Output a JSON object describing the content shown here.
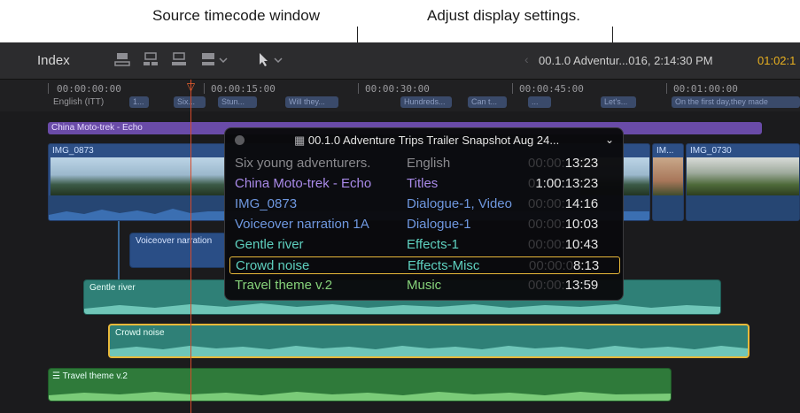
{
  "callouts": {
    "source_timecode": "Source timecode window",
    "display_settings": "Adjust display settings."
  },
  "toolbar": {
    "index_label": "Index",
    "project_name": "00.1.0 Adventur...016, 2:14:30 PM",
    "timecode": "01:02:1"
  },
  "ruler": {
    "marks": [
      "00:00:00:00",
      "00:00:15:00",
      "00:00:30:00",
      "00:00:45:00",
      "00:01:00:00"
    ],
    "caption_lane": "English (ITT)",
    "captions": [
      "1...",
      "Six...",
      "Stun...",
      "Will they...",
      "Hundreds...",
      "Can t...",
      "...",
      "Let's...",
      "On the first day,they made"
    ]
  },
  "timeline": {
    "title_clip": "China Moto-trek - Echo",
    "video_clip_1": "IMG_0873",
    "video_clip_2": "IM...",
    "video_clip_3": "IMG_0730",
    "voiceover_clip": "Voiceover narration",
    "gentle_river_clip": "Gentle river",
    "crowd_noise_clip": "Crowd noise",
    "travel_theme_clip": "Travel theme v.2"
  },
  "popup": {
    "title": "00.1.0 Adventure Trips Trailer Snapshot Aug 24...",
    "rows": [
      {
        "name": "Six young adventurers.",
        "role": "English",
        "tc_dim": "00:00:",
        "tc": "13:23",
        "color": "#8a8a8e",
        "selected": false
      },
      {
        "name": "China Moto-trek - Echo",
        "role": "Titles",
        "tc_dim": "0",
        "tc": "1:00:13:23",
        "color": "#a98ae8",
        "selected": false
      },
      {
        "name": "IMG_0873",
        "role": "Dialogue-1, Video",
        "tc_dim": "00:00:",
        "tc": "14:16",
        "color": "#6f98e0",
        "selected": false
      },
      {
        "name": "Voiceover narration 1A",
        "role": "Dialogue-1",
        "tc_dim": "00:00:",
        "tc": "10:03",
        "color": "#6f98e0",
        "selected": false
      },
      {
        "name": "Gentle river",
        "role": "Effects-1",
        "tc_dim": "00:00:",
        "tc": "10:43",
        "color": "#5ed0bf",
        "selected": false
      },
      {
        "name": "Crowd noise",
        "role": "Effects-Misc",
        "tc_dim": "00:00:0",
        "tc": "8:13",
        "color": "#5ed0bf",
        "selected": true
      },
      {
        "name": "Travel theme v.2",
        "role": "Music",
        "tc_dim": "00:00:",
        "tc": "13:59",
        "color": "#86d27a",
        "selected": false
      }
    ]
  },
  "colors": {
    "playhead": "#d64a2a",
    "selection": "#e8b93a",
    "timecode_accent": "#e8b020"
  }
}
